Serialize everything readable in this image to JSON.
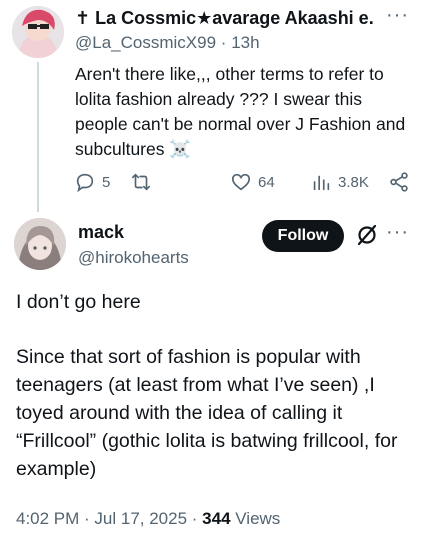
{
  "parent_tweet": {
    "display_name": "✝ La Cossmic★avarage Akaashi e...",
    "handle": "@La_CossmicX99",
    "separator": "·",
    "time": "13h",
    "text": "Aren't there like,,, other terms to refer to lolita fashion already ??? I swear this people can't be normal over J Fashion and subcultures ☠️",
    "replies": "5",
    "retweets": "",
    "likes": "64",
    "views": "3.8K"
  },
  "main_tweet": {
    "display_name": "mack",
    "handle": "@hirokohearts",
    "follow_label": "Follow",
    "paragraph_1": "I don’t go here",
    "paragraph_2": "Since that sort of fashion is popular with teenagers (at least from what I’ve seen) ,I toyed around with the idea of calling it “Frillcool” (gothic lolita is batwing frillcool, for example)",
    "timestamp": "4:02 PM · Jul 17, 2025 · ",
    "views_count": "344",
    "views_label": " Views"
  },
  "colors": {
    "text_primary": "#0f1419",
    "text_secondary": "#536471",
    "thread_line": "#cfd9de",
    "follow_bg": "#0f1419"
  },
  "icons": [
    "reply-icon",
    "retweet-icon",
    "like-icon",
    "views-icon",
    "share-icon",
    "grok-icon",
    "more-icon"
  ]
}
